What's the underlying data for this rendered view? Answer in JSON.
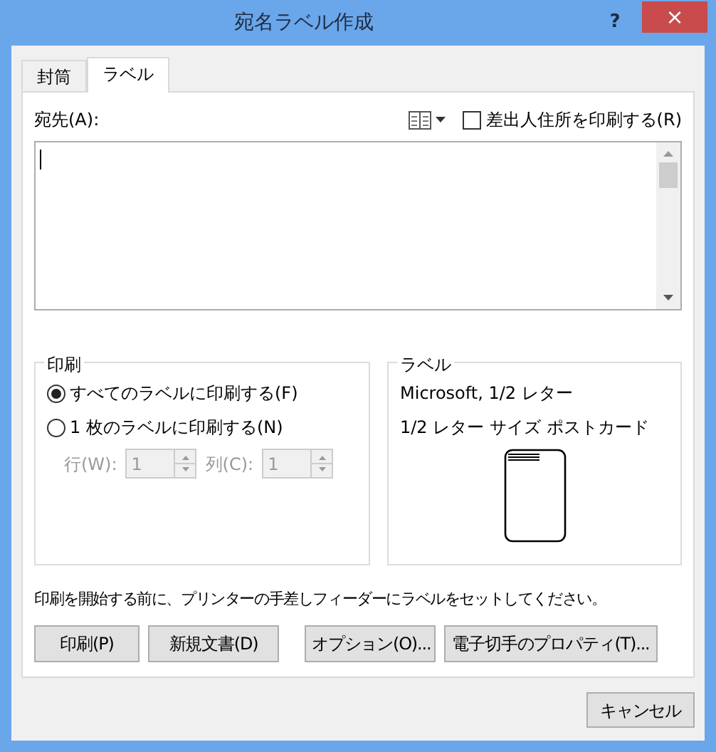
{
  "window": {
    "title": "宛名ラベル作成",
    "help": "?",
    "close": "×"
  },
  "tabs": [
    {
      "label": "封筒",
      "selected": false
    },
    {
      "label": "ラベル",
      "selected": true
    }
  ],
  "address": {
    "label": "宛先(A):",
    "return_address_checkbox": {
      "label": "差出人住所を印刷する(R)",
      "checked": false
    }
  },
  "print_group": {
    "title": "印刷",
    "options": [
      {
        "label": "すべてのラベルに印刷する(F)",
        "selected": true
      },
      {
        "label": "1 枚のラベルに印刷する(N)",
        "selected": false
      }
    ],
    "spinners": [
      {
        "label": "行(W):",
        "value": "1",
        "disabled": true
      },
      {
        "label": "列(C):",
        "value": "1",
        "disabled": true
      }
    ]
  },
  "label_group": {
    "title": "ラベル",
    "lines": [
      "Microsoft, 1/2 レター",
      "1/2 レター サイズ ポストカード"
    ]
  },
  "instruction": "印刷を開始する前に、プリンターの手差しフィーダーにラベルをセットしてください。",
  "buttons": [
    {
      "label": "印刷(P)"
    },
    {
      "label": "新規文書(D)"
    },
    {
      "label": "オプション(O)..."
    },
    {
      "label": "電子切手のプロパティ(T)..."
    }
  ],
  "cancel": "キャンセル"
}
